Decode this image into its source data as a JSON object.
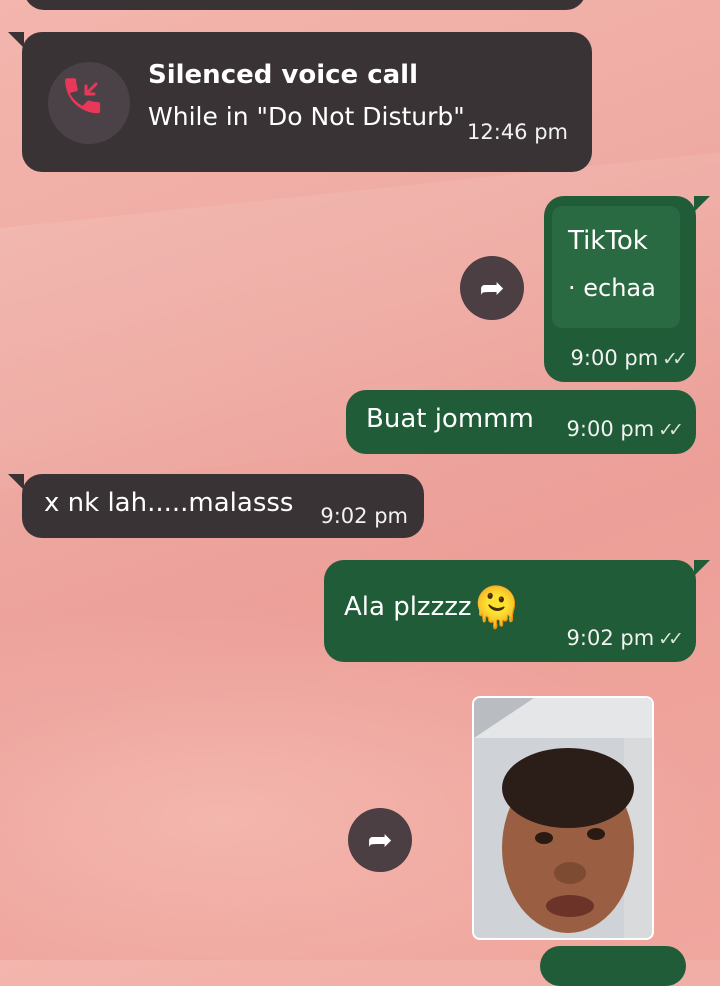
{
  "messages": {
    "call": {
      "title": "Silenced voice call",
      "subtitle": "While in \"Do Not Disturb\"",
      "time": "12:46 pm",
      "icon": "missed-call-icon"
    },
    "tiktok": {
      "title": "TikTok",
      "subtitle": "· echaa",
      "time": "9:00 pm",
      "ticks": "✓✓"
    },
    "buat": {
      "text": "Buat jommm",
      "time": "9:00 pm",
      "ticks": "✓✓"
    },
    "nk": {
      "text": "x nk lah.....malasss",
      "time": "9:02 pm"
    },
    "ala": {
      "text": "Ala plzzzz",
      "emoji": "🫠",
      "time": "9:02 pm",
      "ticks": "✓✓"
    }
  },
  "icons": {
    "forward": "forward-icon",
    "missed_call": "missed-call-icon"
  },
  "colors": {
    "incoming_bubble": "#3a3336",
    "outgoing_bubble": "#1f5c37",
    "call_icon": "#e8385a"
  }
}
